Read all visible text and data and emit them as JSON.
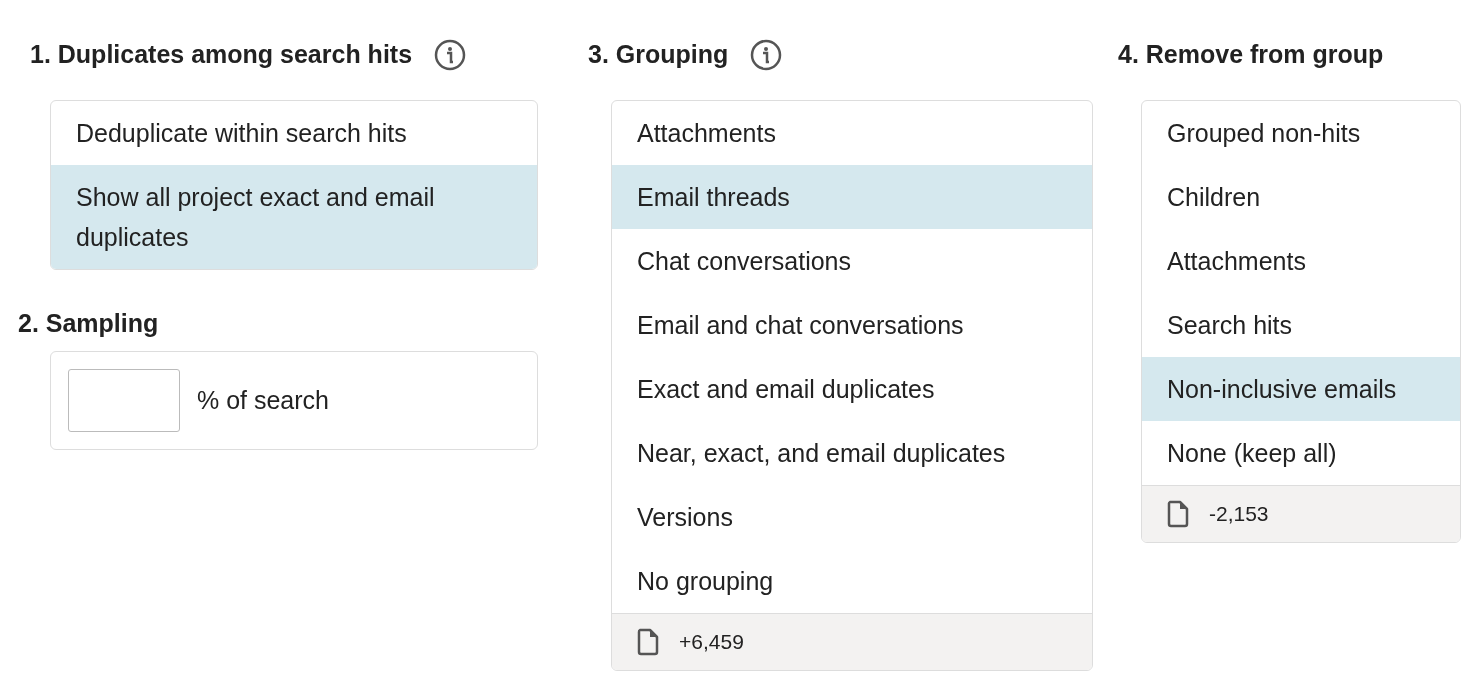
{
  "columns": [
    {
      "sections": [
        {
          "kind": "list",
          "title": "1. Duplicates among search hits",
          "has_info": true,
          "options": [
            {
              "label": "Deduplicate within search hits",
              "selected": false
            },
            {
              "label": "Show all project exact and email duplicates",
              "selected": true
            }
          ]
        },
        {
          "kind": "input",
          "title": "2. Sampling",
          "has_info": false,
          "suffix": "% of search"
        }
      ]
    },
    {
      "sections": [
        {
          "kind": "list",
          "title": "3. Grouping",
          "has_info": true,
          "options": [
            {
              "label": "Attachments",
              "selected": false
            },
            {
              "label": "Email threads",
              "selected": true
            },
            {
              "label": "Chat conversations",
              "selected": false
            },
            {
              "label": "Email and chat conversations",
              "selected": false
            },
            {
              "label": "Exact and email duplicates",
              "selected": false
            },
            {
              "label": "Near, exact, and email duplicates",
              "selected": false
            },
            {
              "label": "Versions",
              "selected": false
            },
            {
              "label": "No grouping",
              "selected": false
            }
          ],
          "count": "+6,459"
        }
      ]
    },
    {
      "sections": [
        {
          "kind": "list",
          "title": "4. Remove from group",
          "has_info": false,
          "options": [
            {
              "label": "Grouped non-hits",
              "selected": false
            },
            {
              "label": "Children",
              "selected": false
            },
            {
              "label": "Attachments",
              "selected": false
            },
            {
              "label": "Search hits",
              "selected": false
            },
            {
              "label": "Non-inclusive emails",
              "selected": true
            },
            {
              "label": "None (keep all)",
              "selected": false
            }
          ],
          "count": "-2,153"
        }
      ]
    }
  ]
}
